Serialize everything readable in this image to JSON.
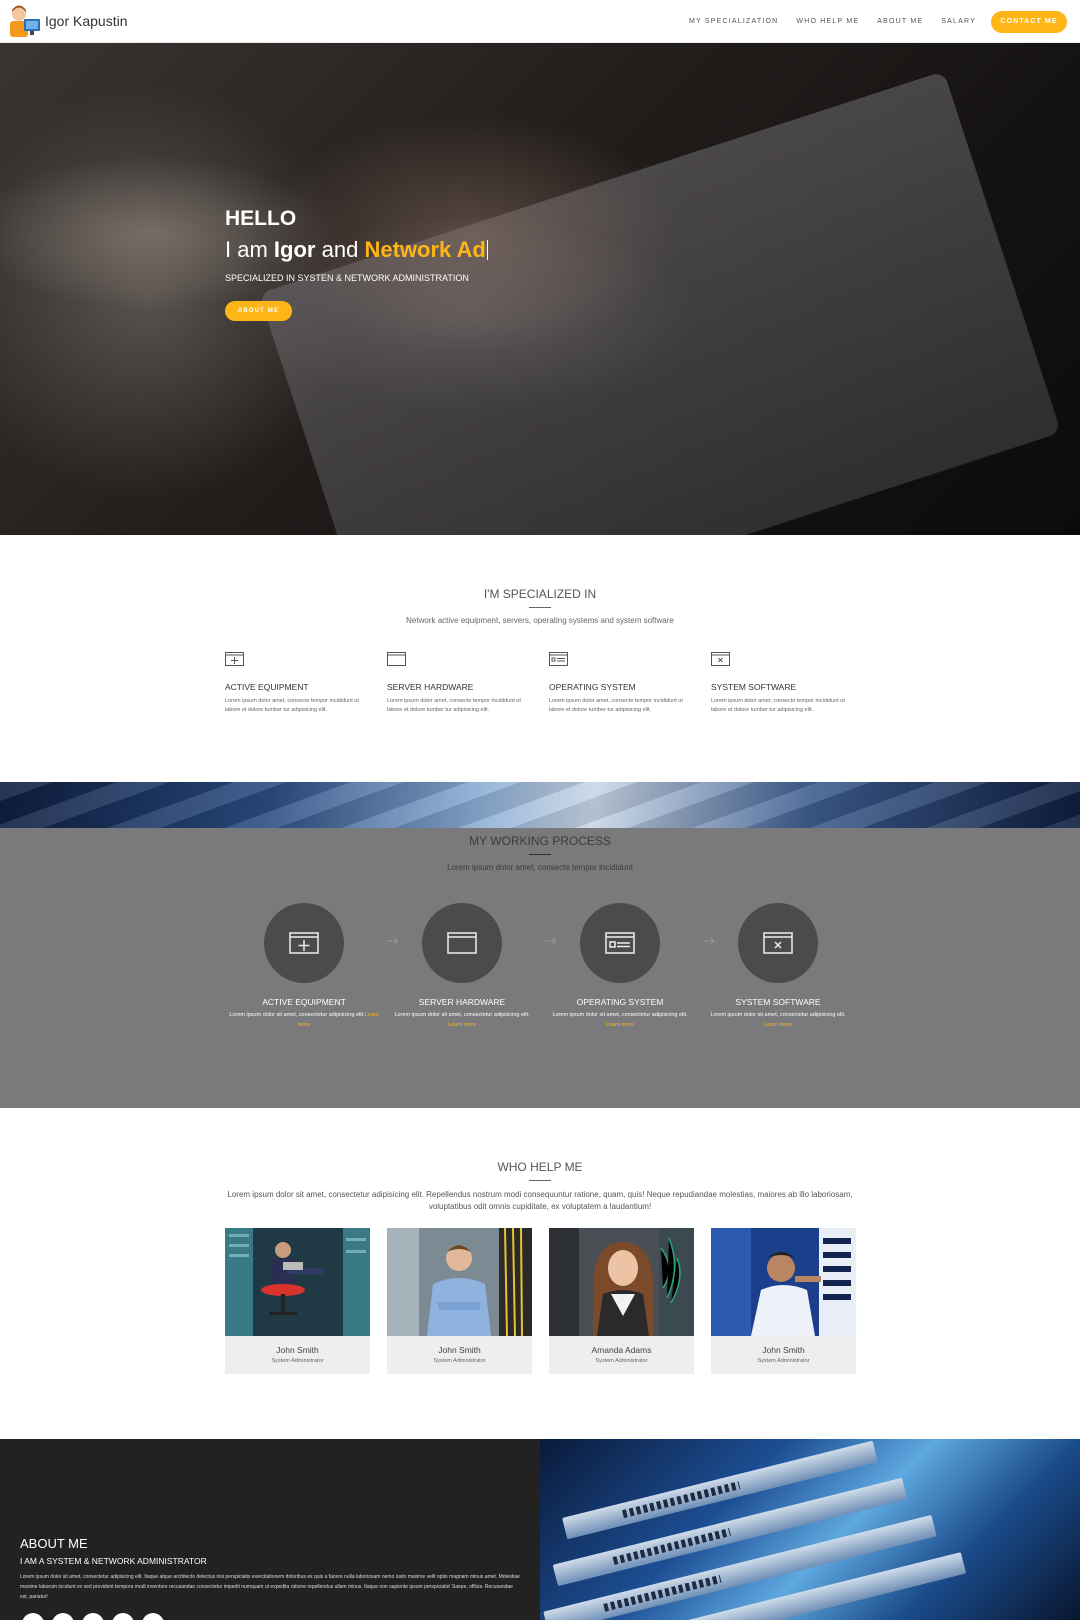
{
  "nav": {
    "brand": "Igor Kapustin",
    "links": [
      "MY SPECIALIZATION",
      "WHO HELP ME",
      "ABOUT ME",
      "SALARY"
    ],
    "cta": "CONTACT ME"
  },
  "hero": {
    "hello": "HELLO",
    "i_am": "I am",
    "name": "Igor",
    "and": "and",
    "typed": "Network Ad",
    "subtitle": "SPECIALIZED IN SYSTEN & NETWORK ADMINISTRATION",
    "button": "ABOUT ME"
  },
  "specialized": {
    "title": "I'M SPECIALIZED IN",
    "subtitle": "Network active equipment, servers, operating systems and system software",
    "items": [
      {
        "title": "ACTIVE EQUIPMENT",
        "text": "Lorem ipsum dolor amet, consecte tempor incididunt ut labore et dolore tumber tur adipisicing elit.",
        "icon": "move-window-icon"
      },
      {
        "title": "SERVER HARDWARE",
        "text": "Lorem ipsum dolor amet, consecte tempor incididunt ut labore et dolore tumber tur adipisicing elit.",
        "icon": "window-icon"
      },
      {
        "title": "OPERATING SYSTEM",
        "text": "Lorem ipsum dolor amet, consecte tempor incididunt ut labore et dolore tumber tur adipisicing elit.",
        "icon": "list-window-icon"
      },
      {
        "title": "SYSTEM SOFTWARE",
        "text": "Lorem ipsum dolor amet, consecte tempor incididunt ut labore et dolore tumber tur adipisicing elit.",
        "icon": "close-window-icon"
      }
    ]
  },
  "process": {
    "title": "MY WORKING PROCESS",
    "subtitle": "Lorem ipsum dolor amet, consecte tempor incididunt",
    "learn_more": "Learn more",
    "items": [
      {
        "title": "ACTIVE EQUIPMENT",
        "text": "Lorem ipsum dolor sit amet, consectetur adipisicing elit."
      },
      {
        "title": "SERVER HARDWARE",
        "text": "Lorem ipsum dolor sit amet, consectetur adipisicing elit."
      },
      {
        "title": "OPERATING SYSTEM",
        "text": "Lorem ipsum dolor sit amet, consectetur adipisicing elit."
      },
      {
        "title": "SYSTEM SOFTWARE",
        "text": "Lorem ipsum dolor sit amet, consectetur adipisicing elit."
      }
    ]
  },
  "team": {
    "title": "WHO HELP ME",
    "description": "Lorem ipsum dolor sit amet, consectetur adipisicing elit. Repellendus nostrum modi consequuntur ratione, quam, quis! Neque repudiandae molestias, maiores ab illo laboriosam, voluptatibus odit omnis cupiditate, ex voluptatem a laudantium!",
    "members": [
      {
        "name": "John Smith",
        "role": "System Administrator"
      },
      {
        "name": "John Smith",
        "role": "System Administrator"
      },
      {
        "name": "Amanda Adams",
        "role": "System Administrator"
      },
      {
        "name": "John Smith",
        "role": "System Administrator"
      }
    ]
  },
  "about": {
    "title": "ABOUT ME",
    "subtitle": "I AM A SYSTEM & NETWORK ADMINISTRATOR",
    "text": "Lorem ipsum dolor sit amet, consectetur adipisicing elit. Itaque atque architecto delectus nisi perspiciatis exercitationem doloribus ex quis a facere nulla laboriosam nemo iusto maxime velit optio magnam minus amet. Molestiae maxime laborum incidunt ex sed provident tempora modi inventore recusandae consectetur impedit numquam ut expedita ratione repellendus ullam minus. Itaque non sapiente ipsum perspiciatis! Saepe, officia. Recusandae est, pariatur!"
  },
  "colors": {
    "accent": "#fdb517",
    "dark": "#232223",
    "process_bg": "#7a797b"
  }
}
